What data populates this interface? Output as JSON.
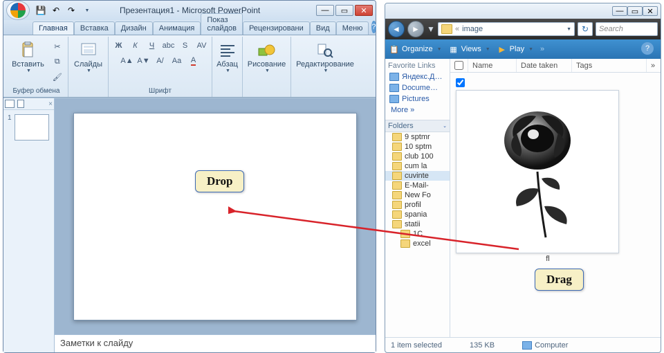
{
  "pp": {
    "title": "Презентация1 - Microsoft PowerPoint",
    "qat": {
      "save": "💾",
      "undo": "↶",
      "redo": "↷"
    },
    "tabs": [
      "Главная",
      "Вставка",
      "Дизайн",
      "Анимация",
      "Показ слайдов",
      "Рецензировани",
      "Вид",
      "Меню"
    ],
    "groups": {
      "clipboard": "Буфер обмена",
      "slides": "Слайды",
      "font": "Шрифт",
      "paragraph": "Абзац",
      "drawing": "Рисование",
      "editing": "Редактирование"
    },
    "paste": "Вставить",
    "notes": "Заметки к слайду",
    "slide_num": "1"
  },
  "ex": {
    "breadcrumb_folder": "image",
    "search_placeholder": "Search",
    "toolbar": {
      "organize": "Organize",
      "views": "Views",
      "play": "Play"
    },
    "fav_label": "Favorite Links",
    "favs": [
      "Яндекс.Д…",
      "Docume…",
      "Pictures"
    ],
    "more": "More »",
    "folders_label": "Folders",
    "folders": [
      "9 sptmr",
      "10 sptm",
      "club 100",
      "cum la",
      "cuvinte",
      "E-Mail-",
      "New Fo",
      "profil",
      "spania",
      "statii",
      "1C",
      "excel"
    ],
    "cols": {
      "name": "Name",
      "date": "Date taken",
      "tags": "Tags"
    },
    "item_name": "fl",
    "status": {
      "sel": "1 item selected",
      "size": "135 KB",
      "loc": "Computer"
    }
  },
  "callouts": {
    "drop": "Drop",
    "drag": "Drag"
  }
}
